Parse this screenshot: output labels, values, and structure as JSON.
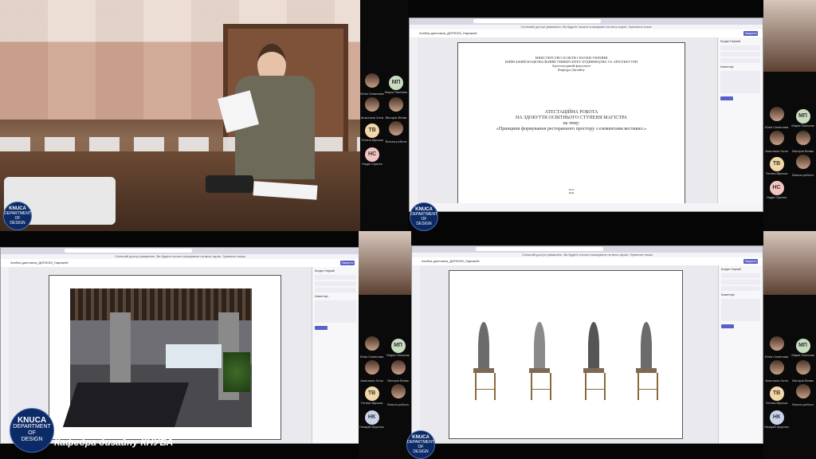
{
  "caption": "Кафедра дизайну КНУБА",
  "logo": {
    "title": "KNUCA",
    "line1": "DEPARTMENT",
    "line2": "OF",
    "line3": "DESIGN"
  },
  "presentation": {
    "ministry": "МІНІСТЕРСТВО ОСВІТИ І НАУКИ УКРАЇНИ",
    "university": "КИЇВСЬКИЙ НАЦІОНАЛЬНИЙ УНІВЕРСИТЕТ БУДІВНИЦТВА ТА АРХІТЕКТУРИ",
    "faculty": "Архітектурний факультет",
    "department": "Кафедра Дизайну",
    "work_title": "АТЕСТАЦІЙНА РОБОТА",
    "degree": "НА ЗДОБУТТЯ ОСВІТНЬОГО СТУПЕНЯ МАГІСТРА",
    "topic_label": "на тему:",
    "topic": "«Принципи формування ресторанного простору з елементами вестикил.»",
    "year": "2022",
    "city": "Київ"
  },
  "window": {
    "tab_title": "Атабна дипломна_ДИПЛОМ_Нарижній",
    "close_label": "Закрити",
    "info_text": "Спільний доступ увімкнено. Ви будете почати показувати на весь екран. Зупинити показ"
  },
  "side_panel": {
    "user": "Богдан Нарізай",
    "label_file": "ТЗ_Нарижній_ДИПЛОМ",
    "label_description": "Інструкції",
    "label_comments": "Коментарі",
    "btn_label": "Здати"
  },
  "participants_top": [
    {
      "initials": "",
      "name": "Юлія Семенова",
      "photo": true
    },
    {
      "initials": "МП",
      "name": "Марія Пасічник",
      "photo": false,
      "color": "#c8dcc0"
    },
    {
      "initials": "",
      "name": "Анастасія Хоткі",
      "photo": true
    },
    {
      "initials": "",
      "name": "Вікторія Вілам",
      "photo": true
    },
    {
      "initials": "ТВ",
      "name": "Тетяна Вірська",
      "photo": false,
      "color": "#f2d7a8"
    },
    {
      "initials": "",
      "name": "Вільна робота",
      "photo": true
    },
    {
      "initials": "НС",
      "name": "Надія Сірятко",
      "photo": false,
      "color": "#f3c4c0"
    }
  ],
  "participants_bottom": [
    {
      "initials": "",
      "name": "Юлія Семенова",
      "photo": true
    },
    {
      "initials": "МП",
      "name": "Марія Пасічник",
      "photo": false,
      "color": "#c8dcc0"
    },
    {
      "initials": "",
      "name": "Анастасія Хоткі",
      "photo": true
    },
    {
      "initials": "",
      "name": "Вікторія Вілам",
      "photo": true
    },
    {
      "initials": "ТВ",
      "name": "Тетяна Вірська",
      "photo": false,
      "color": "#f2d7a8"
    },
    {
      "initials": "",
      "name": "Вільна робота",
      "photo": true
    },
    {
      "initials": "НК",
      "name": "Назарій Куценко",
      "photo": false,
      "color": "#c9d3ea"
    }
  ]
}
